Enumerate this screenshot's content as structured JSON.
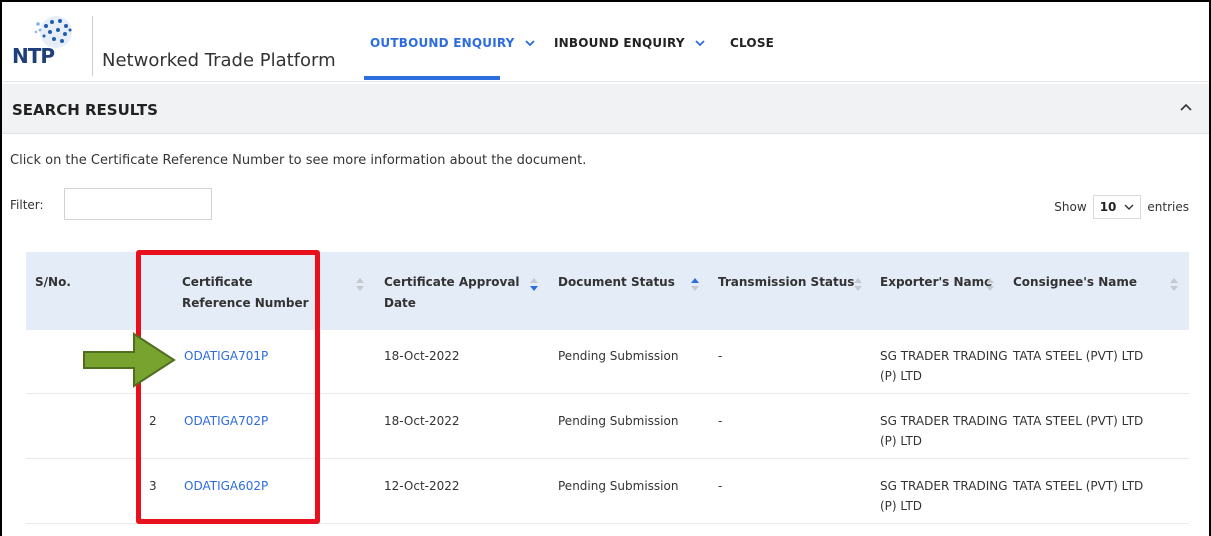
{
  "header": {
    "logo_text": "NTP",
    "brand_name": "Networked Trade Platform",
    "nav": [
      {
        "label": "OUTBOUND ENQUIRY",
        "has_dropdown": true,
        "active": true
      },
      {
        "label": "INBOUND ENQUIRY",
        "has_dropdown": true,
        "active": false
      },
      {
        "label": "CLOSE",
        "has_dropdown": false,
        "active": false
      }
    ],
    "dropdown_icon": "chevron-down-icon"
  },
  "panel": {
    "title": "SEARCH RESULTS",
    "collapse_icon": "chevron-up-icon",
    "info_text": "Click on the Certificate Reference Number to see more information about the document.",
    "filter_label": "Filter:",
    "filter_value": "",
    "show_label": "Show",
    "show_value": "10",
    "entries_label": "entries"
  },
  "table": {
    "columns": [
      {
        "label": "S/No.",
        "sort": "none"
      },
      {
        "label": "Certificate Reference Number",
        "sort": "none"
      },
      {
        "label": "Certificate Approval Date",
        "sort": "desc"
      },
      {
        "label": "Document Status",
        "sort": "asc"
      },
      {
        "label": "Transmission Status",
        "sort": "none"
      },
      {
        "label": "Exporter's Name",
        "sort": "none"
      },
      {
        "label": "Consignee's Name",
        "sort": "none"
      }
    ],
    "rows": [
      {
        "sno": "",
        "ref": "ODATIGA701P",
        "date": "18-Oct-2022",
        "doc_status": "Pending Submission",
        "tx_status": "-",
        "exporter": "SG TRADER TRADING (P) LTD",
        "consignee": "TATA STEEL (PVT) LTD"
      },
      {
        "sno": "2",
        "ref": "ODATIGA702P",
        "date": "18-Oct-2022",
        "doc_status": "Pending Submission",
        "tx_status": "-",
        "exporter": "SG TRADER TRADING (P) LTD",
        "consignee": "TATA STEEL (PVT) LTD"
      },
      {
        "sno": "3",
        "ref": "ODATIGA602P",
        "date": "12-Oct-2022",
        "doc_status": "Pending Submission",
        "tx_status": "-",
        "exporter": "SG TRADER TRADING (P) LTD",
        "consignee": "TATA STEEL (PVT) LTD"
      }
    ]
  },
  "annotations": {
    "highlight_color": "#e8101c",
    "arrow_color": "#77a32e"
  },
  "colors": {
    "accent": "#2d6cdf",
    "table_header_bg": "#e4ecf8",
    "panel_header_bg": "#f1f2f4"
  }
}
